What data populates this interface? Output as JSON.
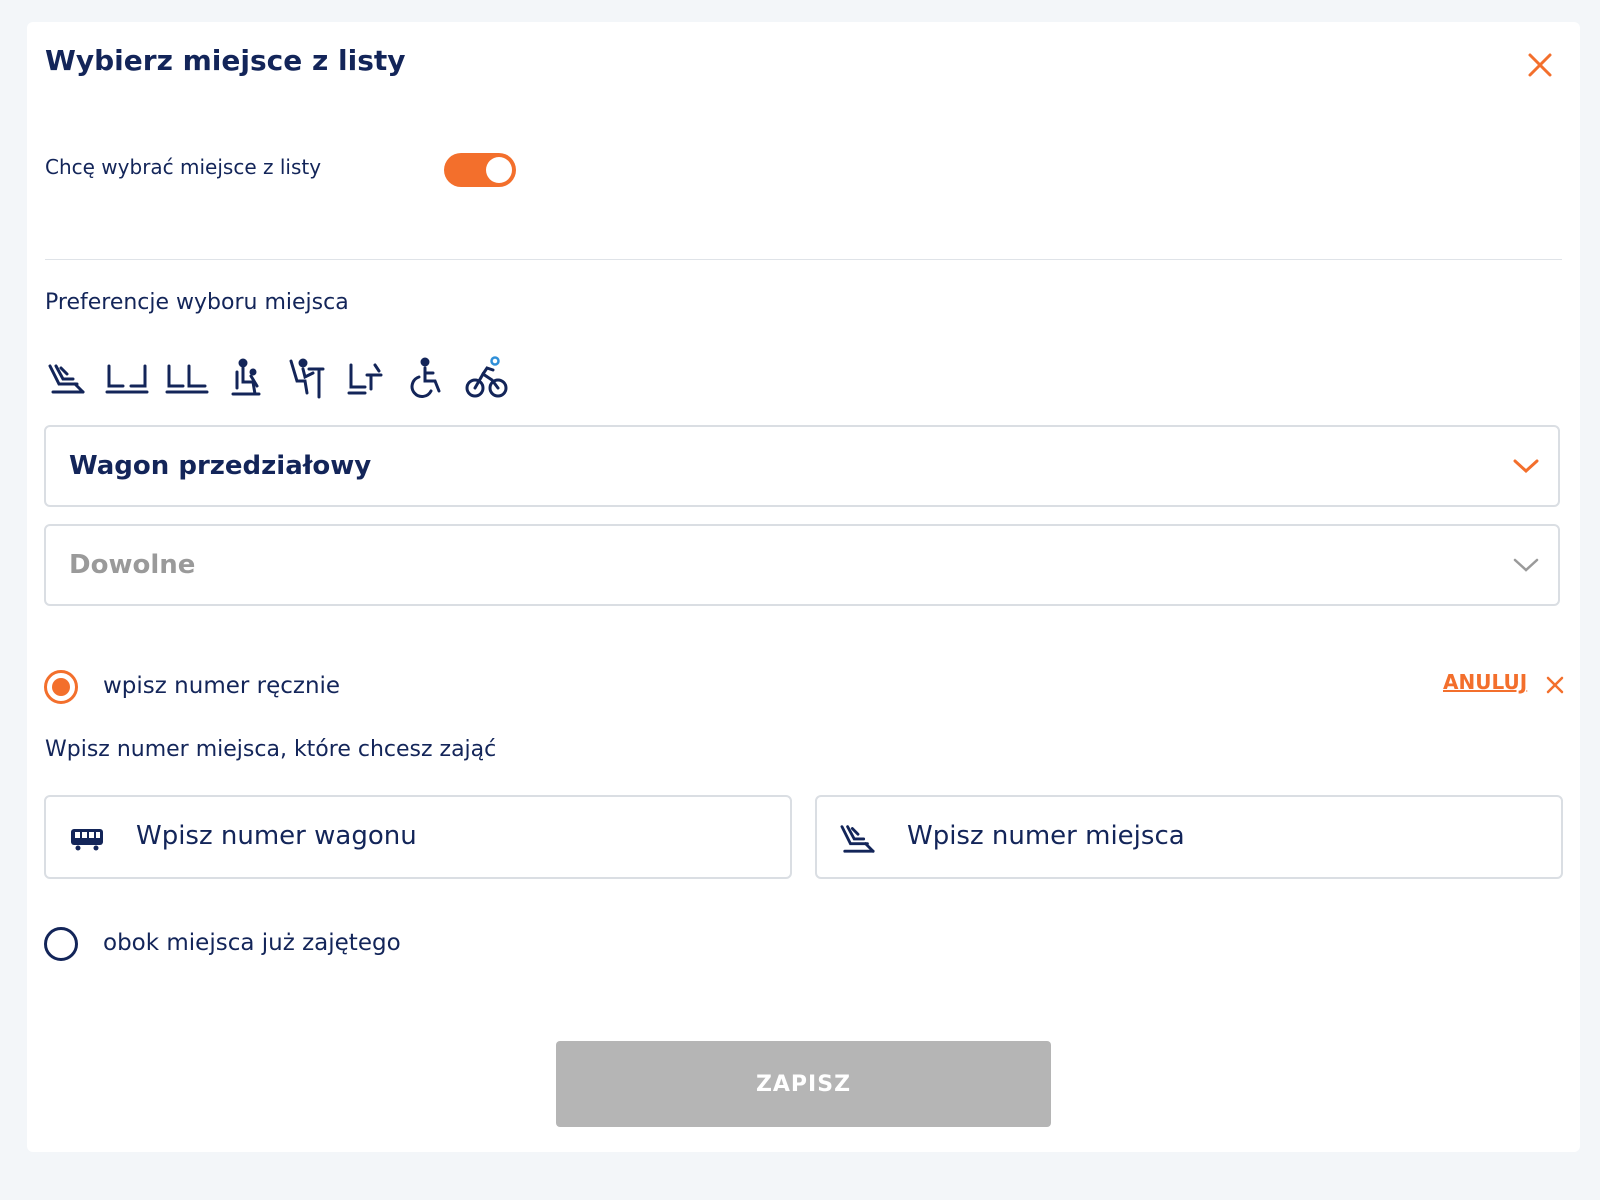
{
  "modal": {
    "title": "Wybierz miejsce z listy",
    "close_icon": "close-icon"
  },
  "toggle": {
    "label": "Chcę wybrać miejsce z listy",
    "state": "on",
    "color": "#f36f2c"
  },
  "preferences": {
    "label": "Preferencje wyboru miejsca",
    "icons": [
      "reclining-seat-icon",
      "seats-facing-icon",
      "seats-row-icon",
      "passenger-with-child-icon",
      "seat-with-table-icon",
      "seat-with-laptop-table-icon",
      "wheelchair-icon",
      "bicycle-icon"
    ]
  },
  "selects": {
    "car_type": "Wagon przedziałowy",
    "seat_option": "Dowolne"
  },
  "manual": {
    "radio_label": "wpisz numer ręcznie",
    "selected": true,
    "cancel_label": "ANULUJ",
    "hint": "Wpisz numer miejsca, które chcesz zająć",
    "car_placeholder": "Wpisz numer wagonu",
    "seat_placeholder": "Wpisz numer miejsca"
  },
  "next_to": {
    "radio_label": "obok miejsca już zajętego",
    "selected": false
  },
  "save_button": "ZAPISZ",
  "colors": {
    "accent": "#f36f2c",
    "text": "#132559",
    "disabled": "#b5b5b5"
  }
}
